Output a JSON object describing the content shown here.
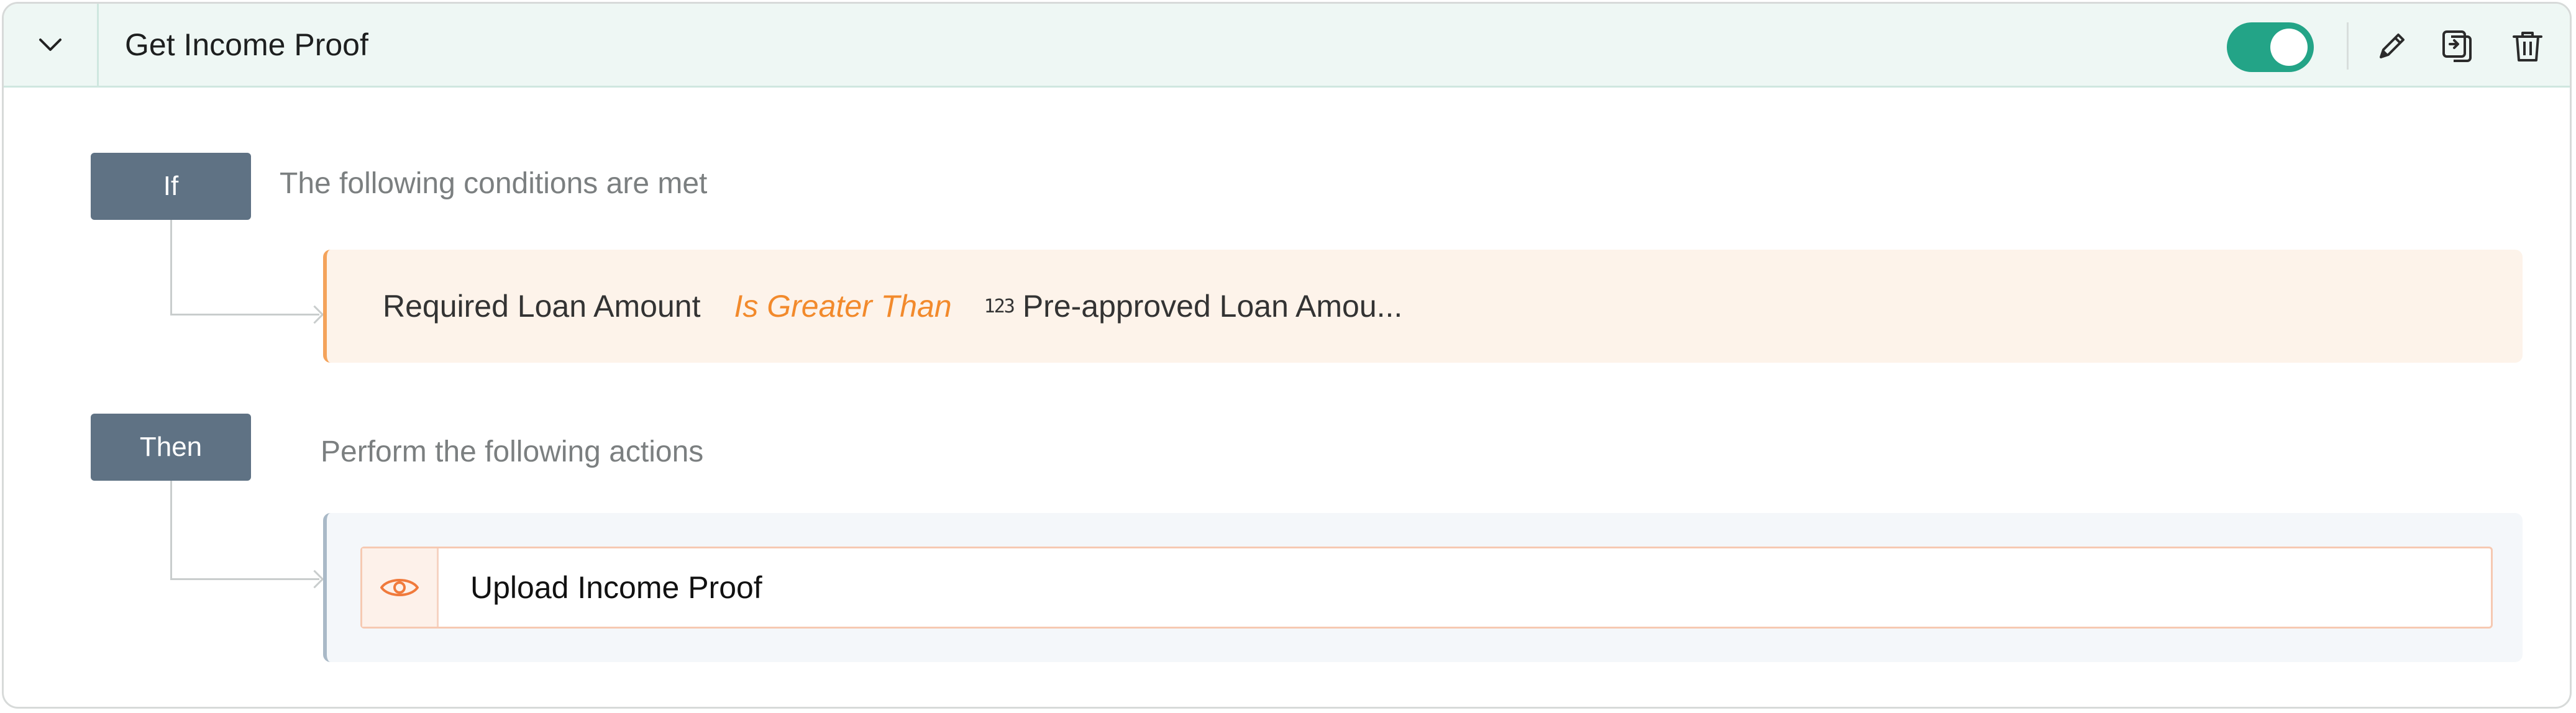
{
  "rule": {
    "title": "Get Income Proof",
    "enabled": true
  },
  "header_icons": {
    "collapse": "chevron-down-icon",
    "edit": "pencil-icon",
    "duplicate": "copy-icon",
    "delete": "trash-icon"
  },
  "if_block": {
    "badge": "If",
    "title": "The following conditions are met",
    "condition": {
      "field": "Required Loan Amount",
      "operator": "Is Greater Than",
      "value_type": "123",
      "value": "Pre-approved Loan Amou..."
    }
  },
  "then_block": {
    "badge": "Then",
    "title": "Perform the following actions",
    "actions": [
      {
        "label": "Upload Income Proof",
        "icon": "eye-icon"
      }
    ]
  },
  "colors": {
    "accent": "#23a487",
    "operator": "#f28a2c",
    "badge": "#5f7284"
  }
}
